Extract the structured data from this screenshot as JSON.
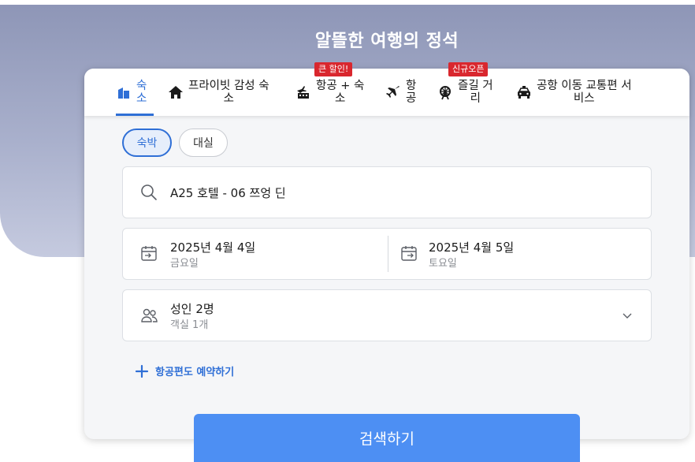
{
  "hero": {
    "title": "알뜰한 여행의 정석"
  },
  "tabs": [
    {
      "id": "stay",
      "label": "숙\n소",
      "icon": "hotel-icon",
      "active": true
    },
    {
      "id": "private",
      "label": "프라이빗 감성 숙\n소",
      "icon": "house-icon",
      "active": false
    },
    {
      "id": "flight_hotel",
      "label": "항공 + 숙\n소",
      "icon": "flight-hotel-icon",
      "badge": "큰 할인!",
      "active": false
    },
    {
      "id": "flight",
      "label": "항\n공",
      "icon": "airplane-icon",
      "active": false
    },
    {
      "id": "activities",
      "label": "즐길 거\n리",
      "icon": "ferris-wheel-icon",
      "badge": "신규오픈",
      "active": false
    },
    {
      "id": "transfer",
      "label": "공항 이동 교통편 서\n비스",
      "icon": "car-icon",
      "active": false
    }
  ],
  "stay_type": {
    "overnight": "숙박",
    "dayuse": "대실"
  },
  "search": {
    "value": "A25 호텔 - 06 쯔엉 딘",
    "icon": "search-icon"
  },
  "checkin": {
    "date": "2025년 4월 4일",
    "weekday": "금요일",
    "icon": "calendar-in-icon"
  },
  "checkout": {
    "date": "2025년 4월 5일",
    "weekday": "토요일",
    "icon": "calendar-out-icon"
  },
  "guests": {
    "adults": "성인 2명",
    "rooms": "객실 1개",
    "icon": "people-icon"
  },
  "add_flight": {
    "label": "항공편도 예약하기",
    "icon": "plus-icon"
  },
  "search_button": {
    "label": "검색하기"
  },
  "colors": {
    "accent": "#2f6fd6",
    "badge": "#d9272e",
    "button": "#4d8ff3"
  }
}
